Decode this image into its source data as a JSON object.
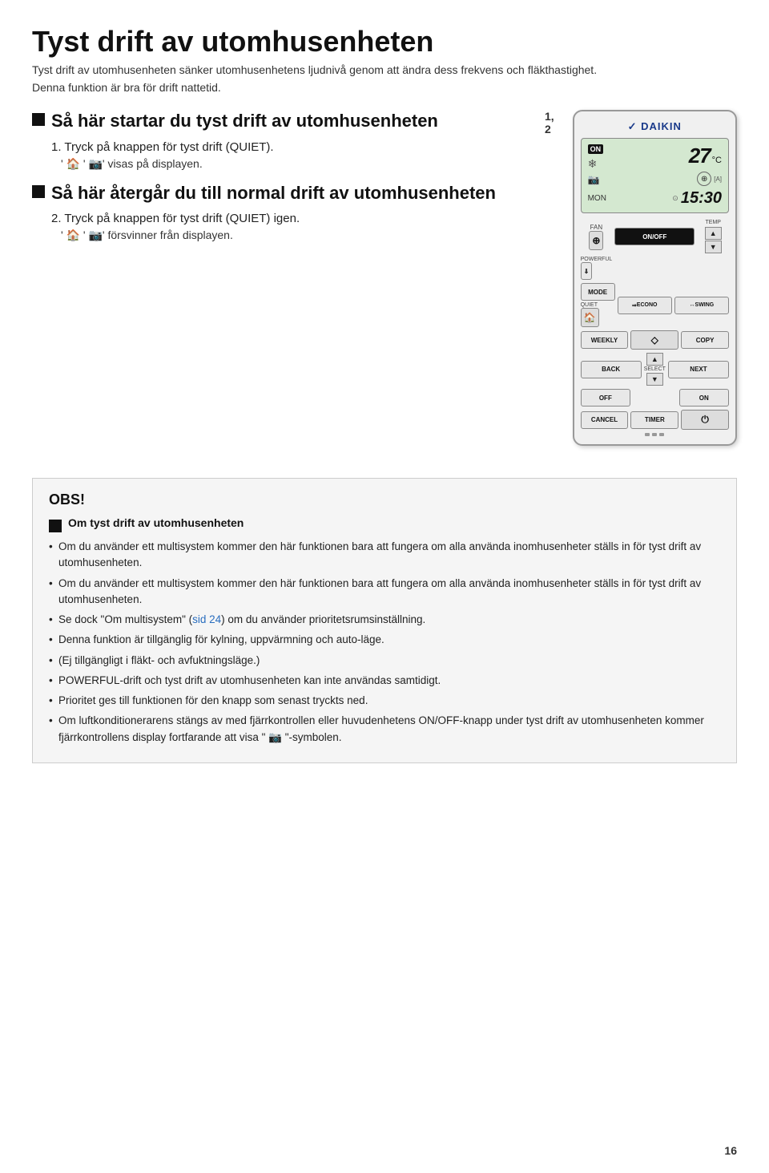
{
  "page": {
    "title": "Tyst drift av utomhusenheten",
    "subtitle": "Tyst drift av utomhusenheten sänker utomhusenhetens ljudnivå genom att ändra dess frekvens och fläkthastighet.",
    "intro": "Denna funktion är bra för drift nattetid.",
    "section1": {
      "title": "Så här startar du tyst drift av utomhusenheten",
      "step1": "1. Tryck på knappen för tyst drift (QUIET).",
      "step1_bullet": "' 📷' visas på displayen."
    },
    "section2": {
      "title": "Så här återgår du till normal drift av utomhusenheten",
      "step1": "2. Tryck på knappen för tyst drift (QUIET) igen.",
      "step1_bullet": "' 📷' försvinner från displayen."
    },
    "label_12": "1, 2",
    "remote": {
      "brand": "DAIKIN",
      "display": {
        "on_label": "ON",
        "temp": "27",
        "unit": "°C",
        "mon": "MON",
        "time": "15:30"
      },
      "buttons": {
        "fan": "FAN",
        "on_off": "ON/OFF",
        "powerful": "POWERFUL",
        "temp": "TEMP",
        "mode": "MODE",
        "econo": "ECONO",
        "swing": "SWING",
        "quiet": "QUIET",
        "weekly": "WEEKLY",
        "diamond": "◇",
        "copy": "COPY",
        "back": "BACK",
        "select": "SELECT",
        "next": "NEXT",
        "off": "OFF",
        "on": "ON",
        "cancel": "CANCEL",
        "timer": "TIMER"
      }
    },
    "obs": {
      "title": "OBS!",
      "section_header": "Om tyst drift av utomhusenheten",
      "bullets": [
        "Om du använder ett multisystem kommer den här funktionen bara att fungera om alla använda inomhusenheter ställs in för tyst drift av utomhusenheten.",
        "Se dock \"Om multisystem\" (sid 24) om du använder prioritetsrumsinställning.",
        "Denna funktion är tillgänglig för kylning, uppvärmning och auto-läge.",
        "(Ej tillgängligt i fläkt- och avfuktningsläge.)",
        "POWERFUL-drift och tyst drift av utomhusenheten kan inte användas samtidigt.",
        "Prioritet ges till funktionen för den knapp som senast tryckts ned.",
        "Om luftkonditionerarens stängs av med fjärrkontrollen eller huvudenhetens ON/OFF-knapp under tyst drift av utomhusenheten kommer fjärrkontrollens display fortfarande att visa \" 📷 \"-symbolen."
      ]
    },
    "page_number": "16"
  }
}
